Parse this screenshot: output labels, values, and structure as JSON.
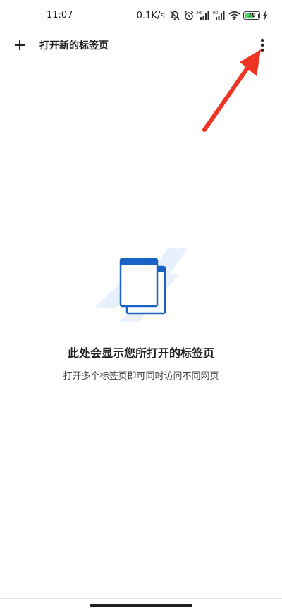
{
  "status_bar": {
    "time": "11:07",
    "net_speed": "0.1K/s",
    "icons": [
      "mute-icon",
      "alarm-icon",
      "signal-hd-icon",
      "signal-hd-icon",
      "wifi-icon"
    ],
    "battery": {
      "level": "70",
      "fraction": 0.7,
      "charging": true,
      "color": "#4cd964"
    }
  },
  "toolbar": {
    "new_tab_label": "打开新的标签页",
    "new_tab_icon": "plus-icon",
    "menu_icon": "more-vert-icon"
  },
  "annotation": {
    "arrow_color": "#ee3424"
  },
  "empty_state": {
    "icon": "tabs-illustration-icon",
    "title": "此处会显示您所打开的标签页",
    "subtitle": "打开多个标签页即可同时访问不同网页",
    "accent_color": "#1a62c5",
    "shape_color": "#e8f0fe"
  }
}
